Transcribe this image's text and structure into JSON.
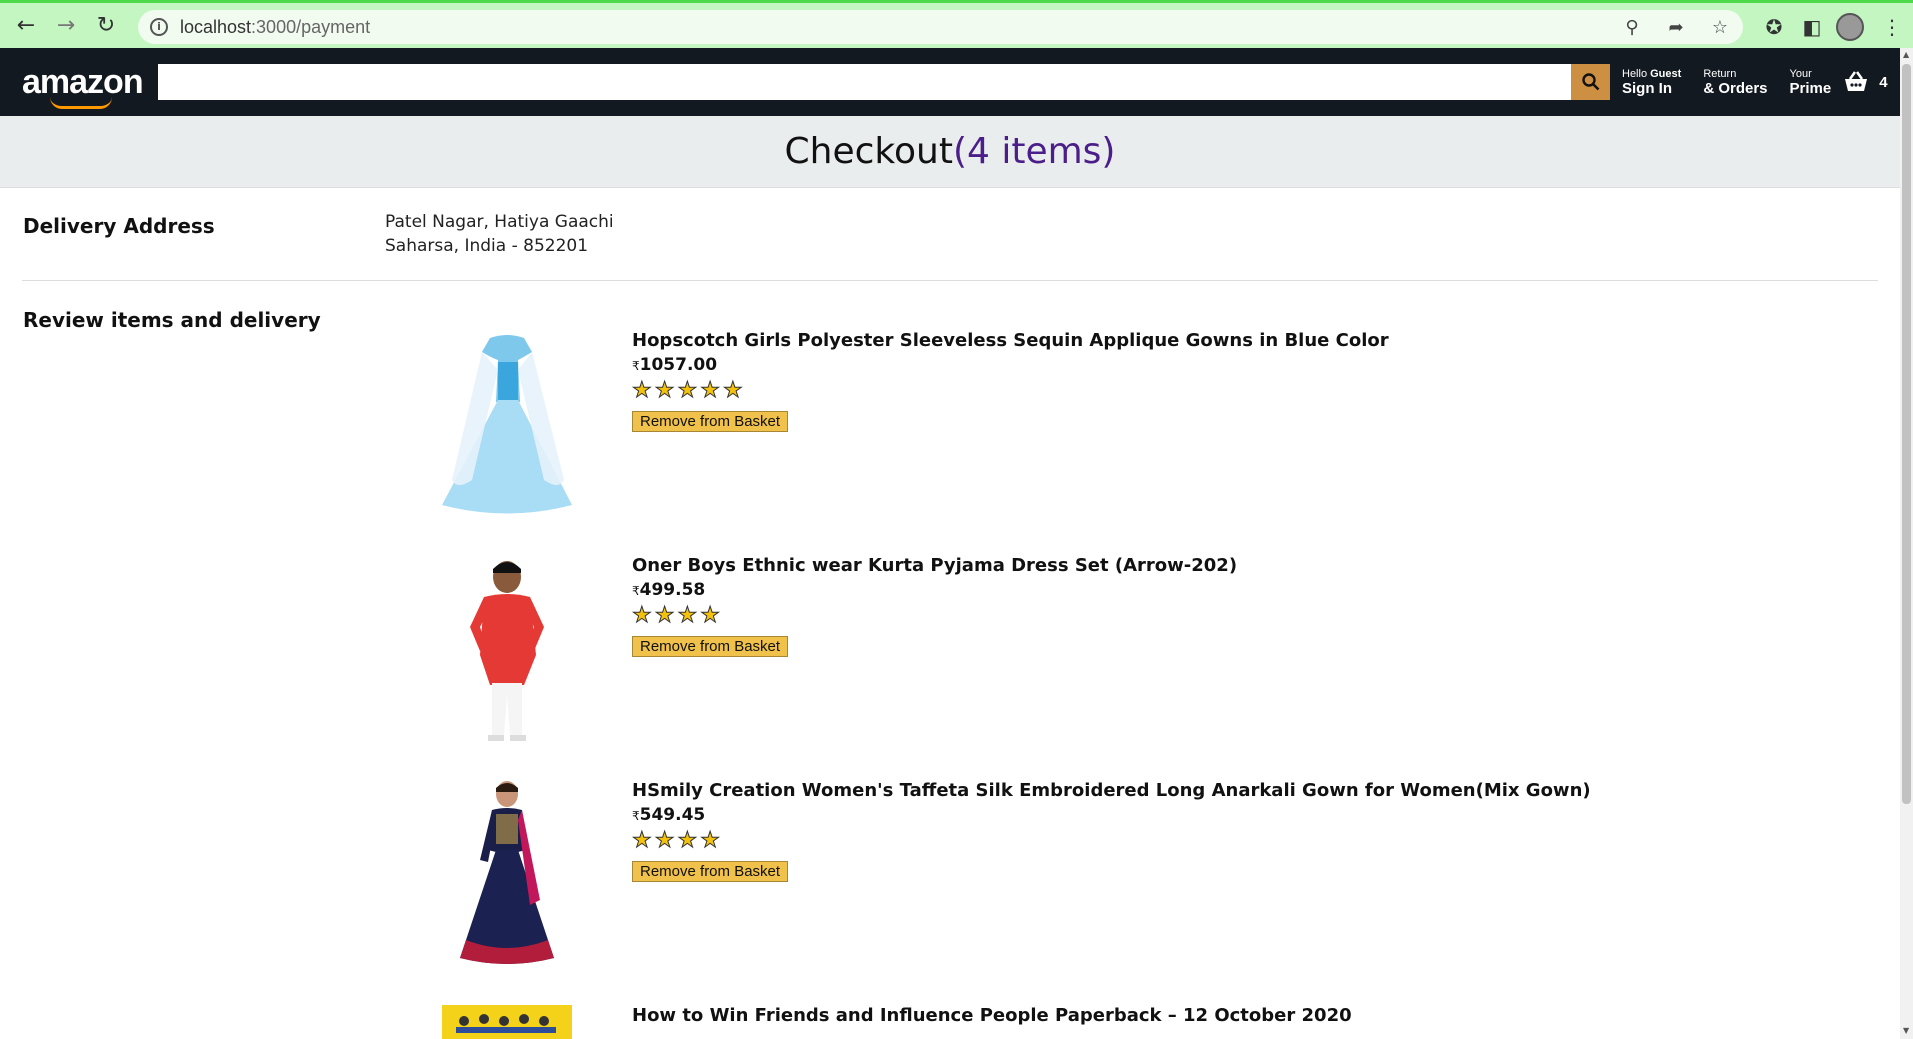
{
  "browser": {
    "url_host": "localhost",
    "url_path": ":3000/payment"
  },
  "header": {
    "logo_text": "amazon",
    "search_placeholder": "",
    "signin_line1_prefix": "Hello ",
    "signin_line1_name": "Guest",
    "signin_line2": "Sign In",
    "orders_line1": "Return",
    "orders_line2": "& Orders",
    "prime_line1": "Your",
    "prime_line2": "Prime",
    "basket_count": "4"
  },
  "checkout": {
    "title": "Checkout",
    "count_text": "(4 items)"
  },
  "delivery": {
    "title": "Delivery Address",
    "line1": "Patel Nagar, Hatiya Gaachi",
    "line2": "Saharsa, India - 852201"
  },
  "review": {
    "title": "Review items and delivery",
    "remove_label": "Remove from Basket",
    "currency": "₹",
    "items": [
      {
        "title": "Hopscotch Girls Polyester Sleeveless Sequin Applique Gowns in Blue Color",
        "price": "1057.00",
        "rating": 5
      },
      {
        "title": "Oner Boys Ethnic wear Kurta Pyjama Dress Set (Arrow-202)",
        "price": "499.58",
        "rating": 4
      },
      {
        "title": "HSmily Creation Women's Taffeta Silk Embroidered Long Anarkali Gown for Women(Mix Gown)",
        "price": "549.45",
        "rating": 4
      },
      {
        "title": "How to Win Friends and Influence People Paperback – 12 October 2020",
        "price": "",
        "rating": 0
      }
    ]
  }
}
